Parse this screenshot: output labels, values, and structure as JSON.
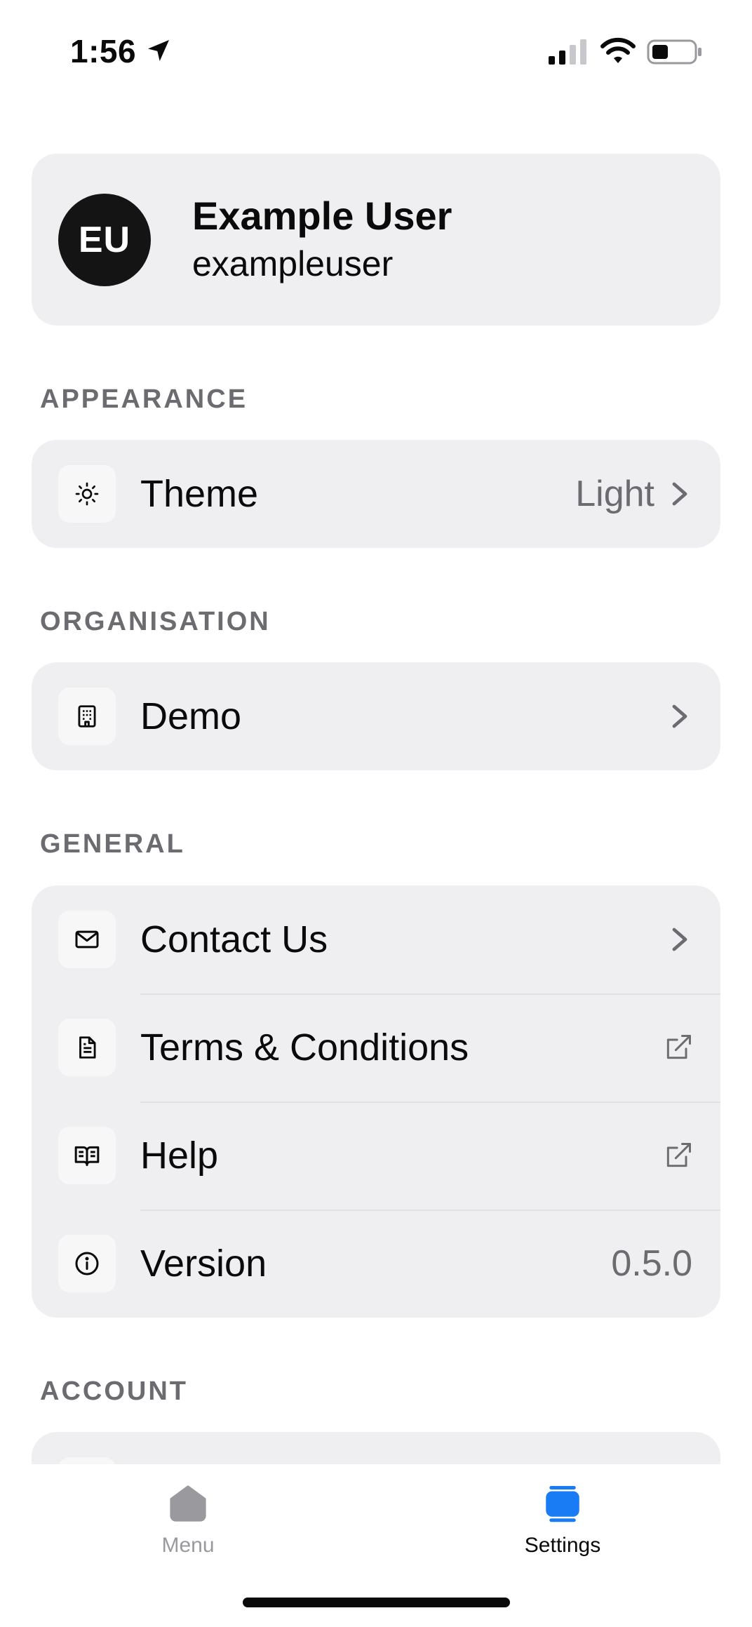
{
  "status_bar": {
    "time": "1:56"
  },
  "profile": {
    "initials": "EU",
    "name": "Example User",
    "username": "exampleuser"
  },
  "sections": {
    "appearance": {
      "header": "APPEARANCE",
      "theme_label": "Theme",
      "theme_value": "Light"
    },
    "organisation": {
      "header": "ORGANISATION",
      "org_label": "Demo"
    },
    "general": {
      "header": "GENERAL",
      "contact_label": "Contact Us",
      "terms_label": "Terms & Conditions",
      "help_label": "Help",
      "version_label": "Version",
      "version_value": "0.5.0"
    },
    "account": {
      "header": "ACCOUNT"
    }
  },
  "tab_bar": {
    "menu_label": "Menu",
    "settings_label": "Settings",
    "active_tab": "Settings"
  },
  "colors": {
    "accent": "#1a7cf5",
    "card_bg": "#efeff1",
    "secondary_text": "#6b6b70",
    "avatar_bg": "#141414"
  },
  "icons": {
    "theme": "sun-icon",
    "organisation": "building-icon",
    "contact": "envelope-icon",
    "terms": "document-icon",
    "help": "book-icon",
    "version": "info-icon",
    "external": "external-link-icon",
    "menu_tab": "home-icon",
    "settings_tab": "layers-icon"
  }
}
